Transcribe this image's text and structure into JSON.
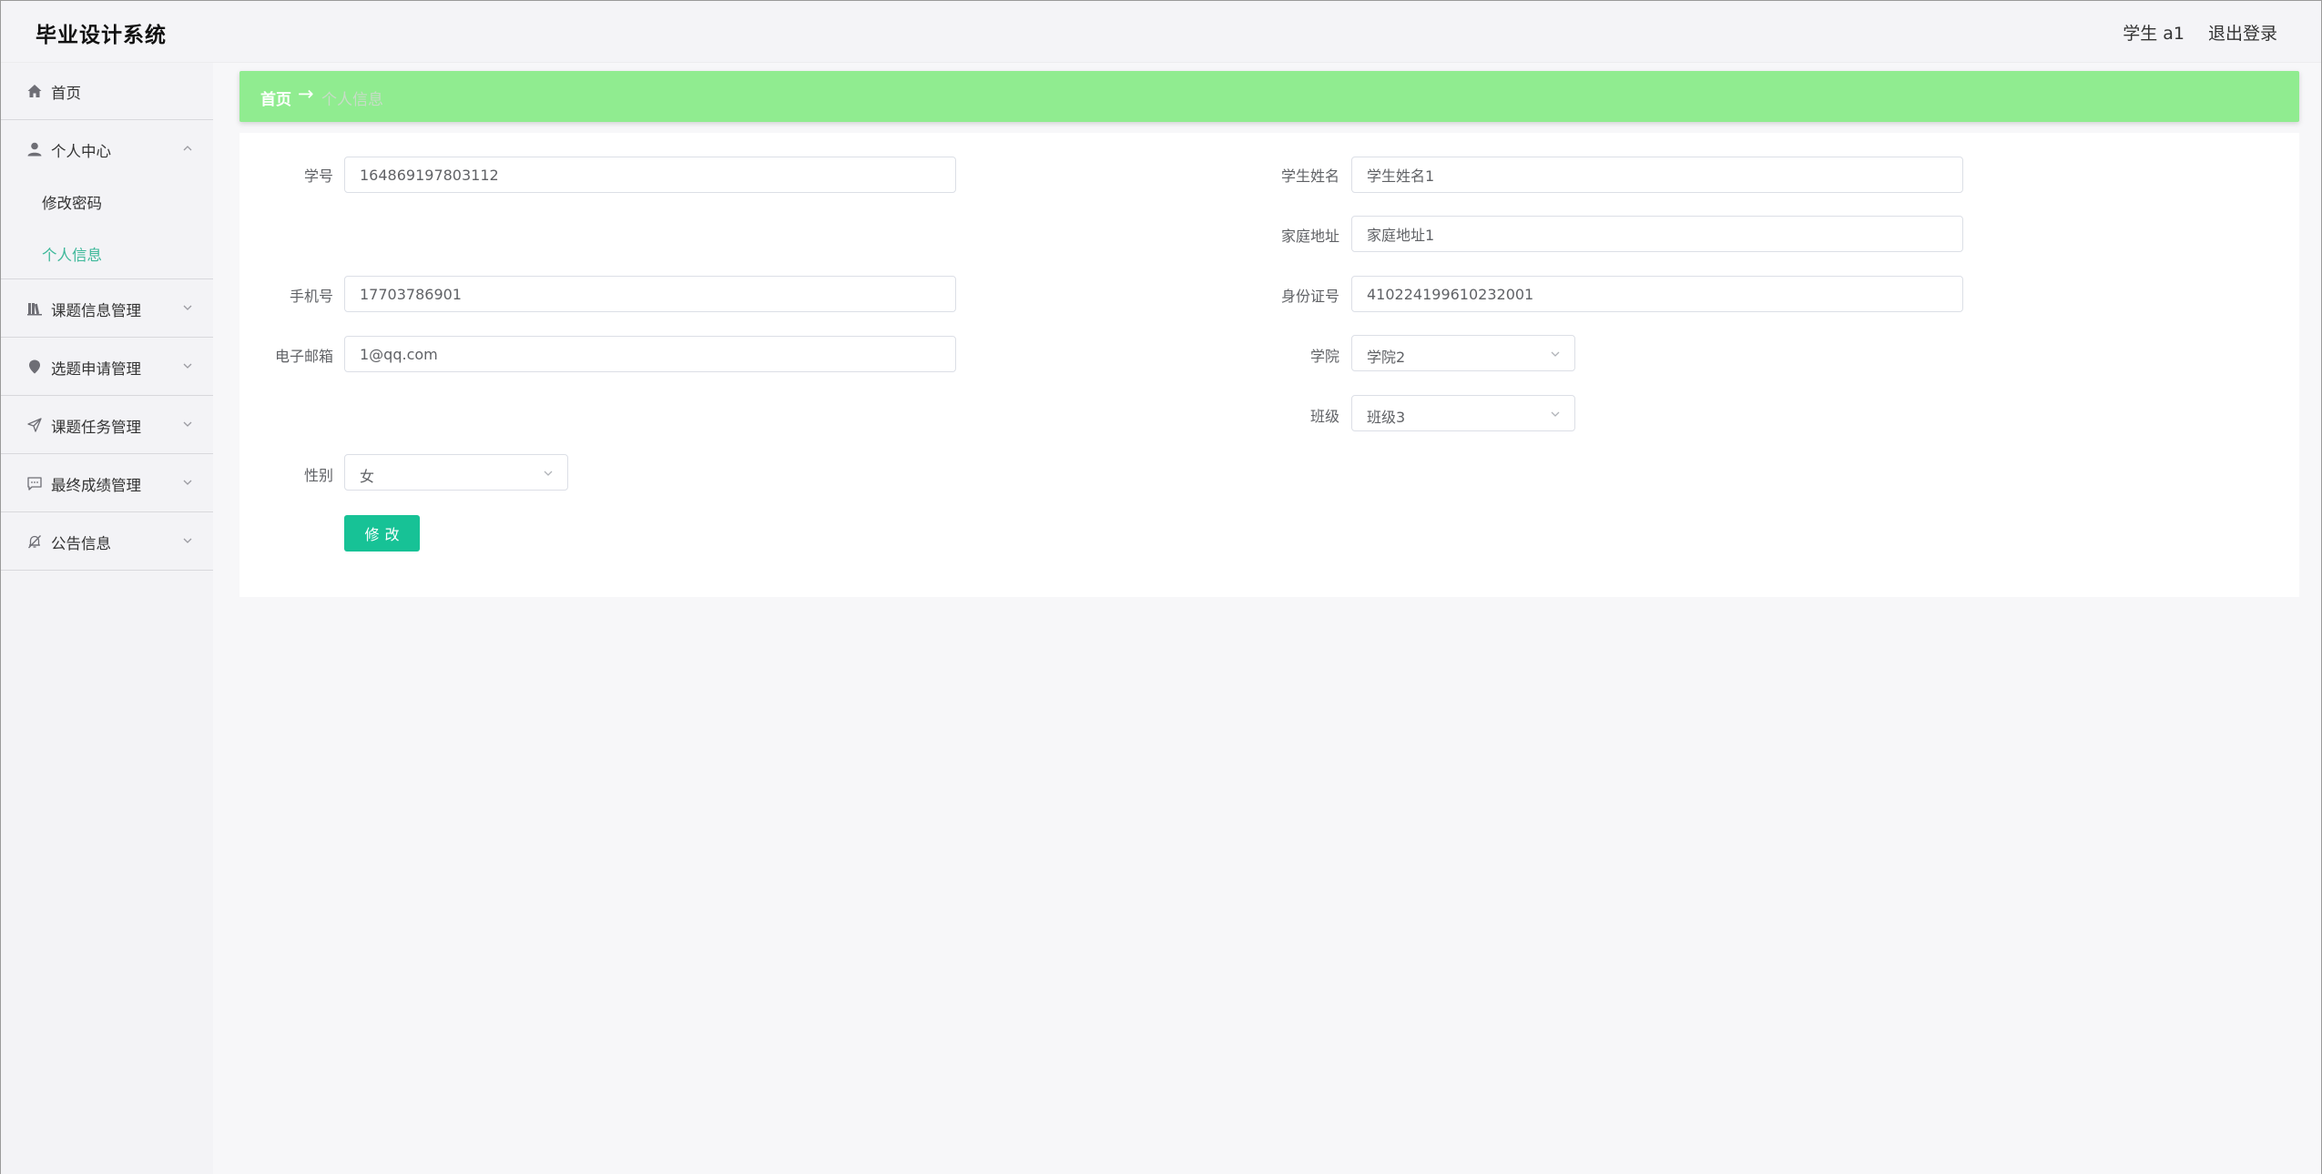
{
  "header": {
    "app_title": "毕业设计系统",
    "user_label": "学生 a1",
    "logout_label": "退出登录"
  },
  "sidebar": {
    "items": [
      {
        "label": "首页",
        "icon": "home-icon"
      },
      {
        "label": "个人中心",
        "icon": "user-icon",
        "expanded": true,
        "children": [
          {
            "label": "修改密码",
            "active": false
          },
          {
            "label": "个人信息",
            "active": true
          }
        ]
      },
      {
        "label": "课题信息管理",
        "icon": "book-icon"
      },
      {
        "label": "选题申请管理",
        "icon": "location-pin-icon"
      },
      {
        "label": "课题任务管理",
        "icon": "send-icon"
      },
      {
        "label": "最终成绩管理",
        "icon": "message-icon"
      },
      {
        "label": "公告信息",
        "icon": "bell-off-icon"
      }
    ],
    "active_color": "#3eb89a"
  },
  "breadcrumb": {
    "home": "首页",
    "separator": "→",
    "current": "个人信息",
    "background": "#90ec90"
  },
  "form": {
    "student_id": {
      "label": "学号",
      "value": "164869197803112"
    },
    "student_name": {
      "label": "学生姓名",
      "value": "学生姓名1"
    },
    "home_address": {
      "label": "家庭地址",
      "value": "家庭地址1"
    },
    "phone": {
      "label": "手机号",
      "value": "17703786901"
    },
    "id_card": {
      "label": "身份证号",
      "value": "410224199610232001"
    },
    "email": {
      "label": "电子邮箱",
      "value": "1@qq.com"
    },
    "college": {
      "label": "学院",
      "value": "学院2"
    },
    "class": {
      "label": "班级",
      "value": "班级3"
    },
    "gender": {
      "label": "性别",
      "value": "女"
    },
    "submit_label": "修改",
    "submit_color": "#17c296"
  }
}
